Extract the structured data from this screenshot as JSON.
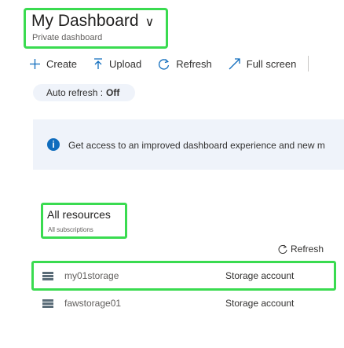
{
  "header": {
    "title": "My Dashboard",
    "subtitle": "Private dashboard",
    "chevron": "∨"
  },
  "toolbar": {
    "create": "Create",
    "upload": "Upload",
    "refresh": "Refresh",
    "fullscreen": "Full screen"
  },
  "auto_refresh": {
    "label": "Auto refresh :",
    "value": "Off"
  },
  "banner": {
    "text": "Get access to an improved dashboard experience and new m"
  },
  "resources": {
    "title": "All resources",
    "subtitle": "All subscriptions",
    "refresh_label": "Refresh",
    "rows": [
      {
        "name": "my01storage",
        "type": "Storage account"
      },
      {
        "name": "fawstorage01",
        "type": "Storage account"
      }
    ]
  },
  "colors": {
    "highlight": "#3adb50",
    "banner_bg": "#eff3fa",
    "info_icon": "#0f6cbd"
  }
}
